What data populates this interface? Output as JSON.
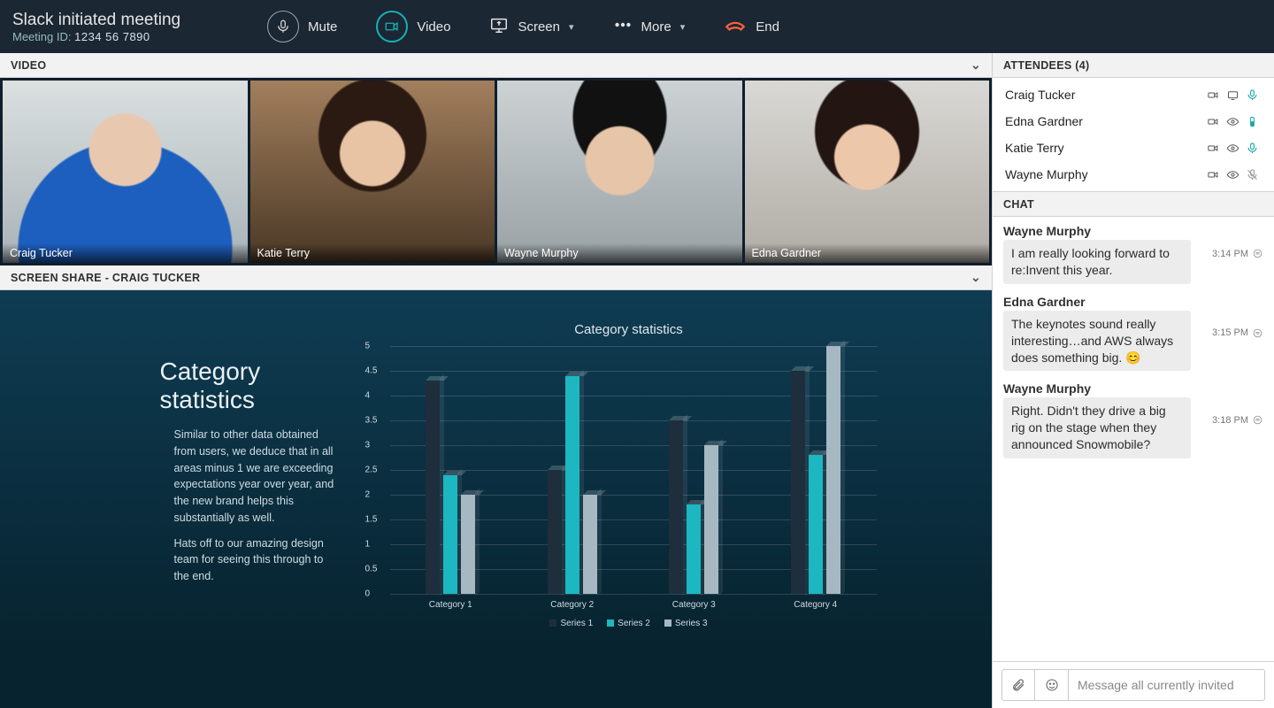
{
  "header": {
    "title": "Slack initiated meeting",
    "meeting_id_label": "Meeting ID:",
    "meeting_id": "1234 56 7890",
    "controls": {
      "mute": "Mute",
      "video": "Video",
      "screen": "Screen",
      "more": "More",
      "end": "End"
    }
  },
  "sections": {
    "video": "VIDEO",
    "screenshare": "SCREEN SHARE - CRAIG TUCKER",
    "attendees": "ATTENDEES (4)",
    "chat": "CHAT"
  },
  "video_tiles": [
    {
      "name": "Craig Tucker"
    },
    {
      "name": "Katie Terry"
    },
    {
      "name": "Wayne Murphy"
    },
    {
      "name": "Edna Gardner"
    }
  ],
  "attendees": [
    {
      "name": "Craig Tucker",
      "cam": true,
      "share": "screen",
      "mic": "active"
    },
    {
      "name": "Edna Gardner",
      "cam": true,
      "share": "watch",
      "mic": "level"
    },
    {
      "name": "Katie Terry",
      "cam": true,
      "share": "watch",
      "mic": "active"
    },
    {
      "name": "Wayne Murphy",
      "cam": true,
      "share": "watch",
      "mic": "muted"
    }
  ],
  "chat": [
    {
      "author": "Wayne Murphy",
      "text": "I am really looking forward to re:Invent this year.",
      "time": "3:14 PM"
    },
    {
      "author": "Edna Gardner",
      "text": "The keynotes sound really interesting…and AWS always does something big.        😊",
      "time": "3:15 PM"
    },
    {
      "author": "Wayne Murphy",
      "text": "Right. Didn't they drive a big rig on the stage when they announced Snowmobile?",
      "time": "3:18 PM"
    }
  ],
  "chat_input_placeholder": "Message all currently invited",
  "slide": {
    "heading": "Category statistics",
    "para1": "Similar to other data obtained from users, we deduce that in all areas minus 1 we are exceeding expectations year over year, and the new brand helps this substantially as well.",
    "para2": "Hats off to our amazing design team for seeing this through to the end."
  },
  "chart_data": {
    "type": "bar",
    "title": "Category statistics",
    "ylabel": "",
    "xlabel": "",
    "ylim": [
      0,
      5
    ],
    "yticks": [
      0,
      0.5,
      1,
      1.5,
      2,
      2.5,
      3,
      3.5,
      4,
      4.5,
      5
    ],
    "categories": [
      "Category 1",
      "Category 2",
      "Category 3",
      "Category 4"
    ],
    "series": [
      {
        "name": "Series 1",
        "values": [
          4.3,
          2.5,
          3.5,
          4.5
        ]
      },
      {
        "name": "Series 2",
        "values": [
          2.4,
          4.4,
          1.8,
          2.8
        ]
      },
      {
        "name": "Series 3",
        "values": [
          2.0,
          2.0,
          3.0,
          5.0
        ]
      }
    ]
  }
}
